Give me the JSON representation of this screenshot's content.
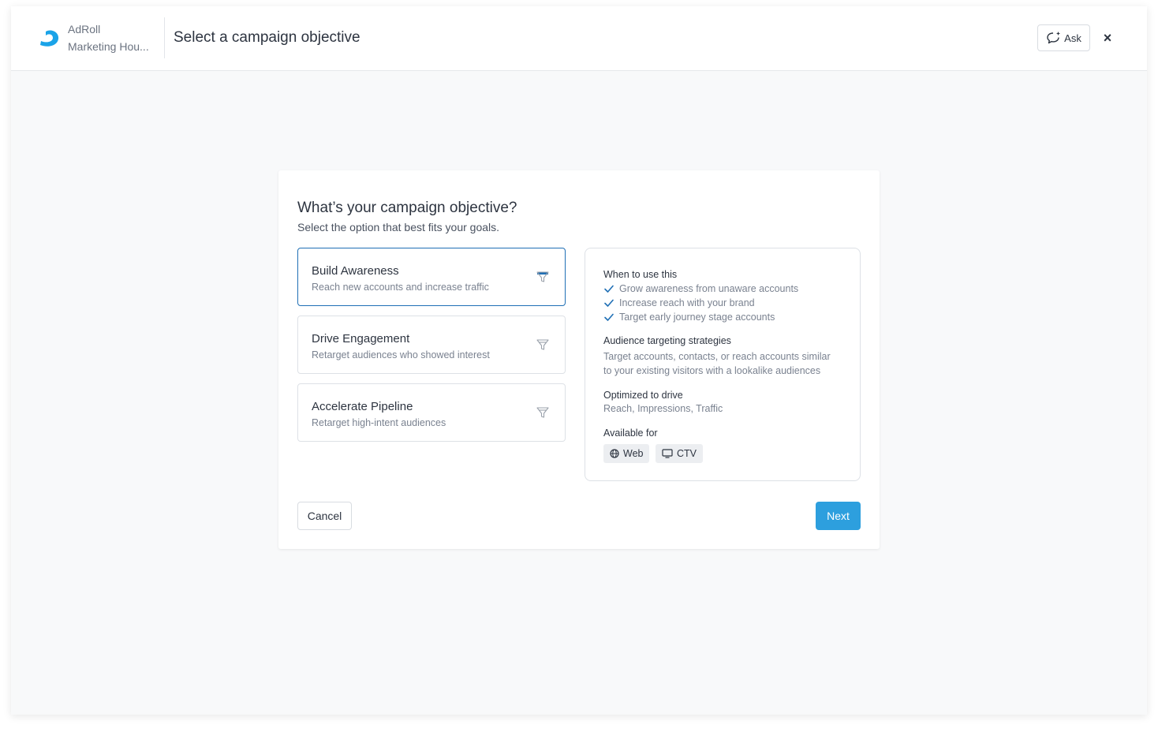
{
  "header": {
    "brand_name": "AdRoll",
    "account_name": "Marketing Hou...",
    "title": "Select a campaign objective",
    "ask_label": "Ask",
    "close_label": "×"
  },
  "main": {
    "title": "What’s your campaign objective?",
    "subtitle": "Select the option that best fits your goals.",
    "options": [
      {
        "title": "Build Awareness",
        "description": "Reach new accounts and increase traffic",
        "selected": true
      },
      {
        "title": "Drive Engagement",
        "description": "Retarget audiences who showed interest",
        "selected": false
      },
      {
        "title": "Accelerate Pipeline",
        "description": "Retarget high-intent audiences",
        "selected": false
      }
    ],
    "details": {
      "when_heading": "When to use this",
      "when_items": [
        "Grow awareness from unaware accounts",
        "Increase reach with your brand",
        "Target early journey stage accounts"
      ],
      "strategies_heading": "Audience targeting strategies",
      "strategies_text_1": "Target accounts, contacts, or reach accounts similar",
      "strategies_text_2": "to your existing visitors with a lookalike audiences",
      "optimized_heading": "Optimized to drive",
      "optimized_text": "Reach, Impressions, Traffic",
      "available_heading": "Available for",
      "channels": [
        "Web",
        "CTV"
      ]
    },
    "cancel_label": "Cancel",
    "next_label": "Next"
  },
  "colors": {
    "accent": "#2d9fde",
    "selected_border": "#1f6fb5",
    "check": "#1f6fb5",
    "logo": "#1aa3e8"
  },
  "icons": {
    "logo": "adroll-logo-icon",
    "ask": "chat-sparkle-icon",
    "close": "close-icon",
    "option": "funnel-icon",
    "check": "check-icon",
    "web": "globe-icon",
    "ctv": "monitor-icon"
  }
}
